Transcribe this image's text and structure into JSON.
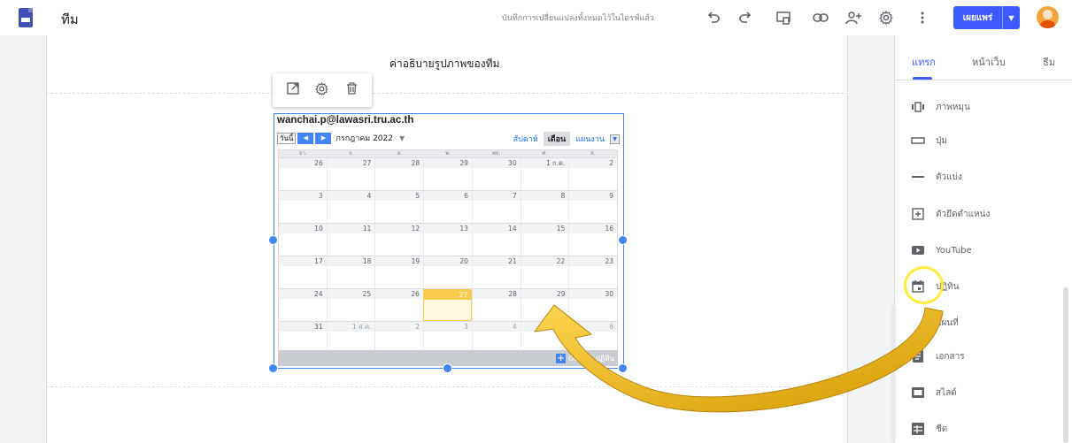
{
  "topbar": {
    "site_title": "ทีม",
    "saved_status": "บันทึกการเปลี่ยนแปลงทั้งหมดไว้ในไดรฟ์แล้ว",
    "publish_label": "เผยแพร่"
  },
  "page": {
    "image_caption": "ค่าอธิบายรูปภาพของทีม"
  },
  "calendar": {
    "owner": "wanchai.p@lawasri.tru.ac.th",
    "today_button": "วันนี้",
    "month": "กรกฎาคม 2022",
    "views": [
      "สัปดาห์",
      "เดือน",
      "แผนงาน"
    ],
    "active_view": "เดือน",
    "weekdays": [
      "อา.",
      "จ.",
      "อ.",
      "พ.",
      "พฤ.",
      "ศ.",
      "ส."
    ],
    "weeks": [
      [
        "26",
        "27",
        "28",
        "29",
        "30",
        "1 ก.ค.",
        "2"
      ],
      [
        "3",
        "4",
        "5",
        "6",
        "7",
        "8",
        "9"
      ],
      [
        "10",
        "11",
        "12",
        "13",
        "14",
        "15",
        "16"
      ],
      [
        "17",
        "18",
        "19",
        "20",
        "21",
        "22",
        "23"
      ],
      [
        "24",
        "25",
        "26",
        "27",
        "28",
        "29",
        "30"
      ],
      [
        "31",
        "1 ส.ค.",
        "2",
        "3",
        "4",
        "5",
        "6"
      ]
    ],
    "today": "27",
    "footer_link": "Google ปฏิทิน"
  },
  "panel": {
    "tabs": [
      "แทรก",
      "หน้าเว็บ",
      "ธีม"
    ],
    "active_tab": "แทรก",
    "items": [
      {
        "label": "ภาพหมุน",
        "icon": "carousel-icon"
      },
      {
        "label": "ปุ่ม",
        "icon": "button-icon"
      },
      {
        "label": "ตัวแบ่ง",
        "icon": "divider-icon"
      },
      {
        "label": "ตัวยึดตำแหน่ง",
        "icon": "placeholder-icon"
      },
      {
        "label": "YouTube",
        "icon": "youtube-icon"
      },
      {
        "label": "ปฏิทิน",
        "icon": "calendar-icon"
      },
      {
        "label": "แผนที่",
        "icon": "map-icon"
      },
      {
        "label": "เอกสาร",
        "icon": "docs-icon"
      },
      {
        "label": "สไลด์",
        "icon": "slides-icon"
      },
      {
        "label": "ชีต",
        "icon": "sheets-icon"
      }
    ]
  },
  "colors": {
    "accent": "#3d5afe",
    "calendar_blue": "#4285f4",
    "today_highlight": "#f7cb4d",
    "annotation_arrow": "#e6a800",
    "annotation_ring": "#ffeb3b"
  }
}
